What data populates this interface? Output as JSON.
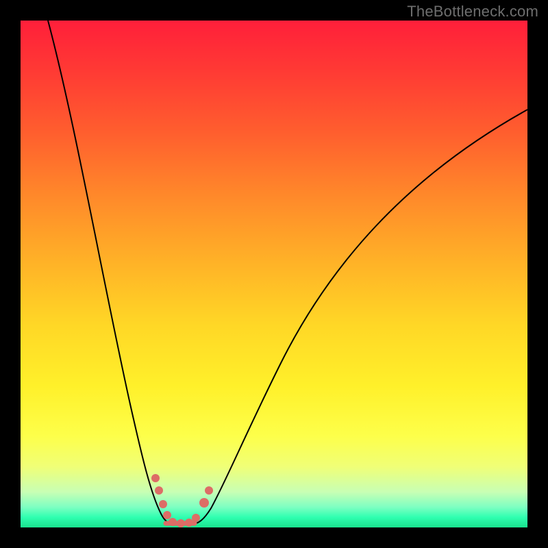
{
  "watermark": "TheBottleneck.com",
  "chart_data": {
    "type": "line",
    "title": "",
    "xlabel": "",
    "ylabel": "",
    "xlim": [
      0,
      100
    ],
    "ylim": [
      0,
      100
    ],
    "grid": false,
    "legend": false,
    "x": [
      0,
      3,
      6,
      9,
      12,
      15,
      18,
      20,
      22,
      24,
      26,
      28,
      30,
      33,
      36,
      40,
      45,
      50,
      55,
      60,
      65,
      70,
      75,
      80,
      85,
      90,
      95,
      100
    ],
    "values": [
      100,
      88,
      77,
      66,
      55,
      44,
      33,
      24,
      16,
      9,
      4,
      1,
      0,
      0,
      2,
      6,
      13,
      22,
      32,
      42,
      52,
      60,
      67,
      72,
      76,
      79,
      81,
      82
    ],
    "flat_region_x": [
      26,
      33
    ],
    "markers": [
      {
        "x": 22.5,
        "y": 11
      },
      {
        "x": 23.5,
        "y": 8
      },
      {
        "x": 25.0,
        "y": 4
      },
      {
        "x": 26.5,
        "y": 1.5
      },
      {
        "x": 28.0,
        "y": 0.6
      },
      {
        "x": 30.0,
        "y": 0.4
      },
      {
        "x": 32.0,
        "y": 0.6
      },
      {
        "x": 34.0,
        "y": 2
      },
      {
        "x": 35.5,
        "y": 5
      },
      {
        "x": 36.5,
        "y": 8
      }
    ],
    "colors": {
      "curve": "#000000",
      "marker": "#dd6d66",
      "gradient_top": "#ff1f3a",
      "gradient_bottom": "#19e38e"
    }
  }
}
